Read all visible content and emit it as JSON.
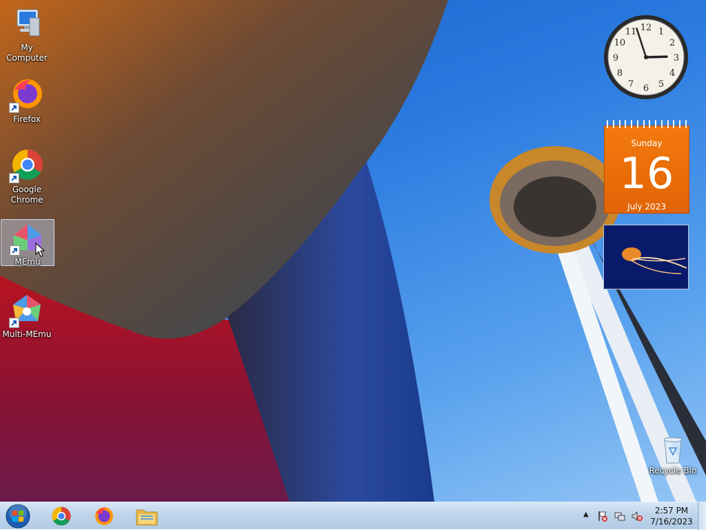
{
  "desktop": {
    "icons": [
      {
        "label": "My Computer",
        "icon": "computer-icon"
      },
      {
        "label": "Firefox",
        "icon": "firefox-icon"
      },
      {
        "label": "Google Chrome",
        "icon": "chrome-icon"
      },
      {
        "label": "MEmu",
        "icon": "memu-icon"
      },
      {
        "label": "Multi-MEmu",
        "icon": "multi-memu-icon"
      },
      {
        "label": "Recycle Bin",
        "icon": "recycle-bin-icon"
      }
    ],
    "selected_icon": "MEmu"
  },
  "gadgets": {
    "clock": {
      "hours": 2,
      "minutes": 57,
      "numerals": [
        "12",
        "1",
        "2",
        "3",
        "4",
        "5",
        "6",
        "7",
        "8",
        "9",
        "10",
        "11"
      ]
    },
    "calendar": {
      "weekday": "Sunday",
      "day": "16",
      "month_year": "July 2023",
      "color": "#f07410"
    },
    "slideshow": {
      "subject": "jellyfish"
    }
  },
  "taskbar": {
    "pinned": [
      "start-orb",
      "chrome-icon",
      "firefox-icon",
      "explorer-icon"
    ],
    "tray": {
      "icons": [
        "action-center-flag-icon",
        "network-icon",
        "volume-muted-icon"
      ],
      "time": "2:57 PM",
      "date": "7/16/2023"
    }
  },
  "colors": {
    "accent": "#f07410",
    "taskbar": "#bcd3ea",
    "sky": "#2a7ae0"
  }
}
